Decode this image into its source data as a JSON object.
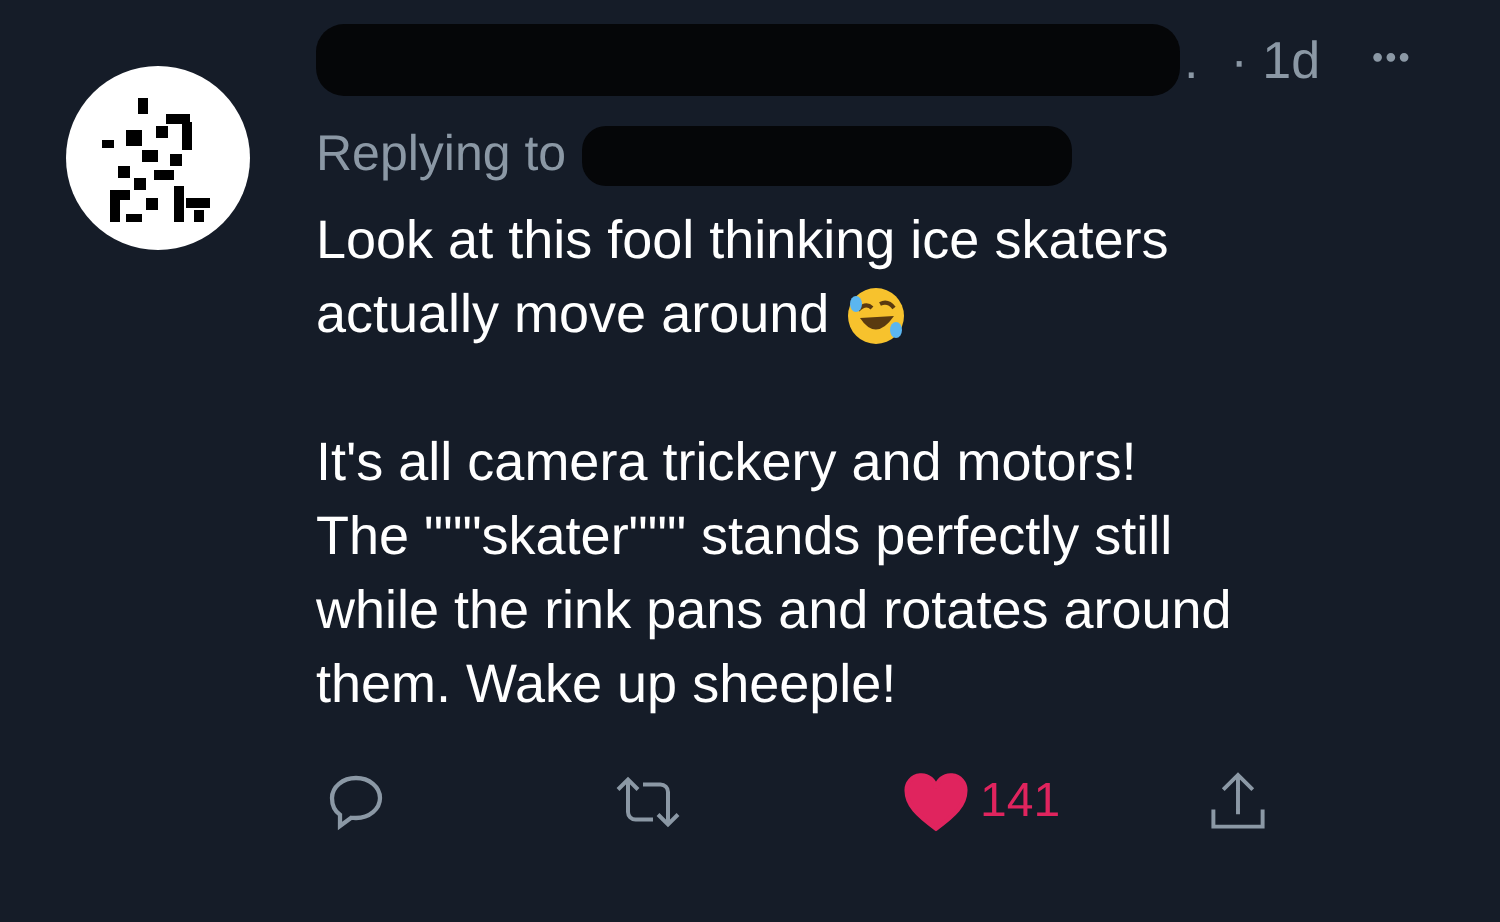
{
  "tweet": {
    "name_suffix": ".",
    "time": "· 1d",
    "more": "•••",
    "replying_to": "Replying to",
    "paragraphs": [
      {
        "lines": [
          "Look at this fool thinking ice skaters",
          "actually move around"
        ]
      },
      {
        "lines": [
          "It's all camera trickery and motors!",
          "The \"\"\"skater\"\"\" stands perfectly still",
          "while the rink pans and rotates around",
          "them. Wake up sheeple!"
        ]
      }
    ],
    "actions": {
      "liked": true,
      "like_count": "141"
    }
  }
}
